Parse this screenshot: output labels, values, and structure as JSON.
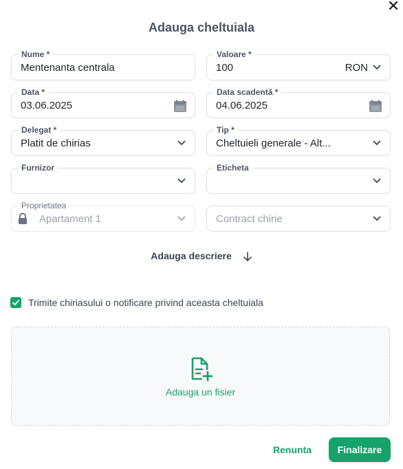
{
  "dialog": {
    "title": "Adauga cheltuiala"
  },
  "fields": {
    "nume": {
      "label": "Nume *",
      "value": "Mentenanta centrala"
    },
    "valoare": {
      "label": "Valoare *",
      "value": "100",
      "currency": "RON"
    },
    "data": {
      "label": "Data *",
      "value": "03.06.2025"
    },
    "data_scadenta": {
      "label": "Data scadentă *",
      "value": "04.06.2025"
    },
    "delegat": {
      "label": "Delegat *",
      "value": "Platit de chirias"
    },
    "tip": {
      "label": "Tip *",
      "value": "Cheltuieli generale - Alt..."
    },
    "furnizor": {
      "label": "Furnizor",
      "value": ""
    },
    "eticheta": {
      "label": "Eticheta",
      "value": ""
    },
    "proprietatea": {
      "label": "Proprietatea",
      "value": "Apartament 1"
    },
    "contract": {
      "placeholder": "Contract chirie"
    }
  },
  "description_toggle": "Adauga descriere",
  "notify": {
    "checked": true,
    "label": "Trimite chiriasului o notificare privind aceasta cheltuiala"
  },
  "upload": {
    "label": "Adauga un fisier"
  },
  "actions": {
    "cancel": "Renunta",
    "finish": "Finalizare"
  },
  "colors": {
    "accent": "#16a36b",
    "border": "#d9dde3",
    "muted_text": "#9aa1ab"
  },
  "icons": [
    "close-icon",
    "chevron-down-icon",
    "calendar-icon",
    "lock-icon",
    "arrow-down-icon",
    "check-icon",
    "file-add-icon"
  ]
}
